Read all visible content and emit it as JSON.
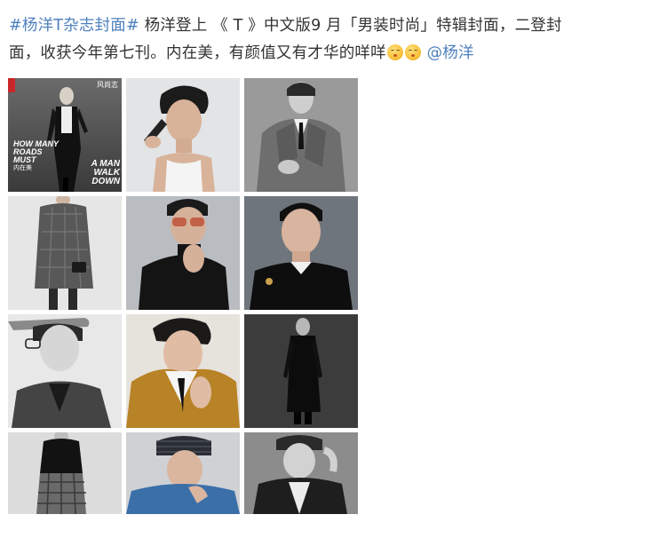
{
  "post": {
    "hashtag": "#杨洋T杂志封面#",
    "line1_text": " 杨洋登上 《 T 》中文版9 月「男装时尚」特辑封面，二登封",
    "line2_text": "面，收获今年第七刊。内在美，有颜值又有才华的咩咩",
    "emojis": [
      "blush-face-emoji",
      "blush-face-emoji"
    ],
    "mention": "@杨洋"
  },
  "cover": {
    "logo": "风尚志",
    "headline": "HOW MANY ROADS MUST",
    "name_cn": "内在美",
    "subhead": "A MAN WALK DOWN"
  },
  "photos": [
    {
      "id": "magazine-cover",
      "style": "bw"
    },
    {
      "id": "white-tank-portrait",
      "style": "color"
    },
    {
      "id": "trench-coat-portrait",
      "style": "bw"
    },
    {
      "id": "plaid-overcoat-full",
      "style": "color"
    },
    {
      "id": "sunglasses-turtleneck",
      "style": "color"
    },
    {
      "id": "black-jacket-portrait",
      "style": "color"
    },
    {
      "id": "cap-glasses-profile",
      "style": "bw"
    },
    {
      "id": "mustard-jacket-portrait",
      "style": "color"
    },
    {
      "id": "long-black-coat-full",
      "style": "bw"
    },
    {
      "id": "tartan-trousers-full",
      "style": "bw"
    },
    {
      "id": "headband-denim-portrait",
      "style": "color"
    },
    {
      "id": "leather-jacket-portrait",
      "style": "bw"
    }
  ],
  "colors": {
    "link": "#4f80be",
    "text": "#333333"
  }
}
